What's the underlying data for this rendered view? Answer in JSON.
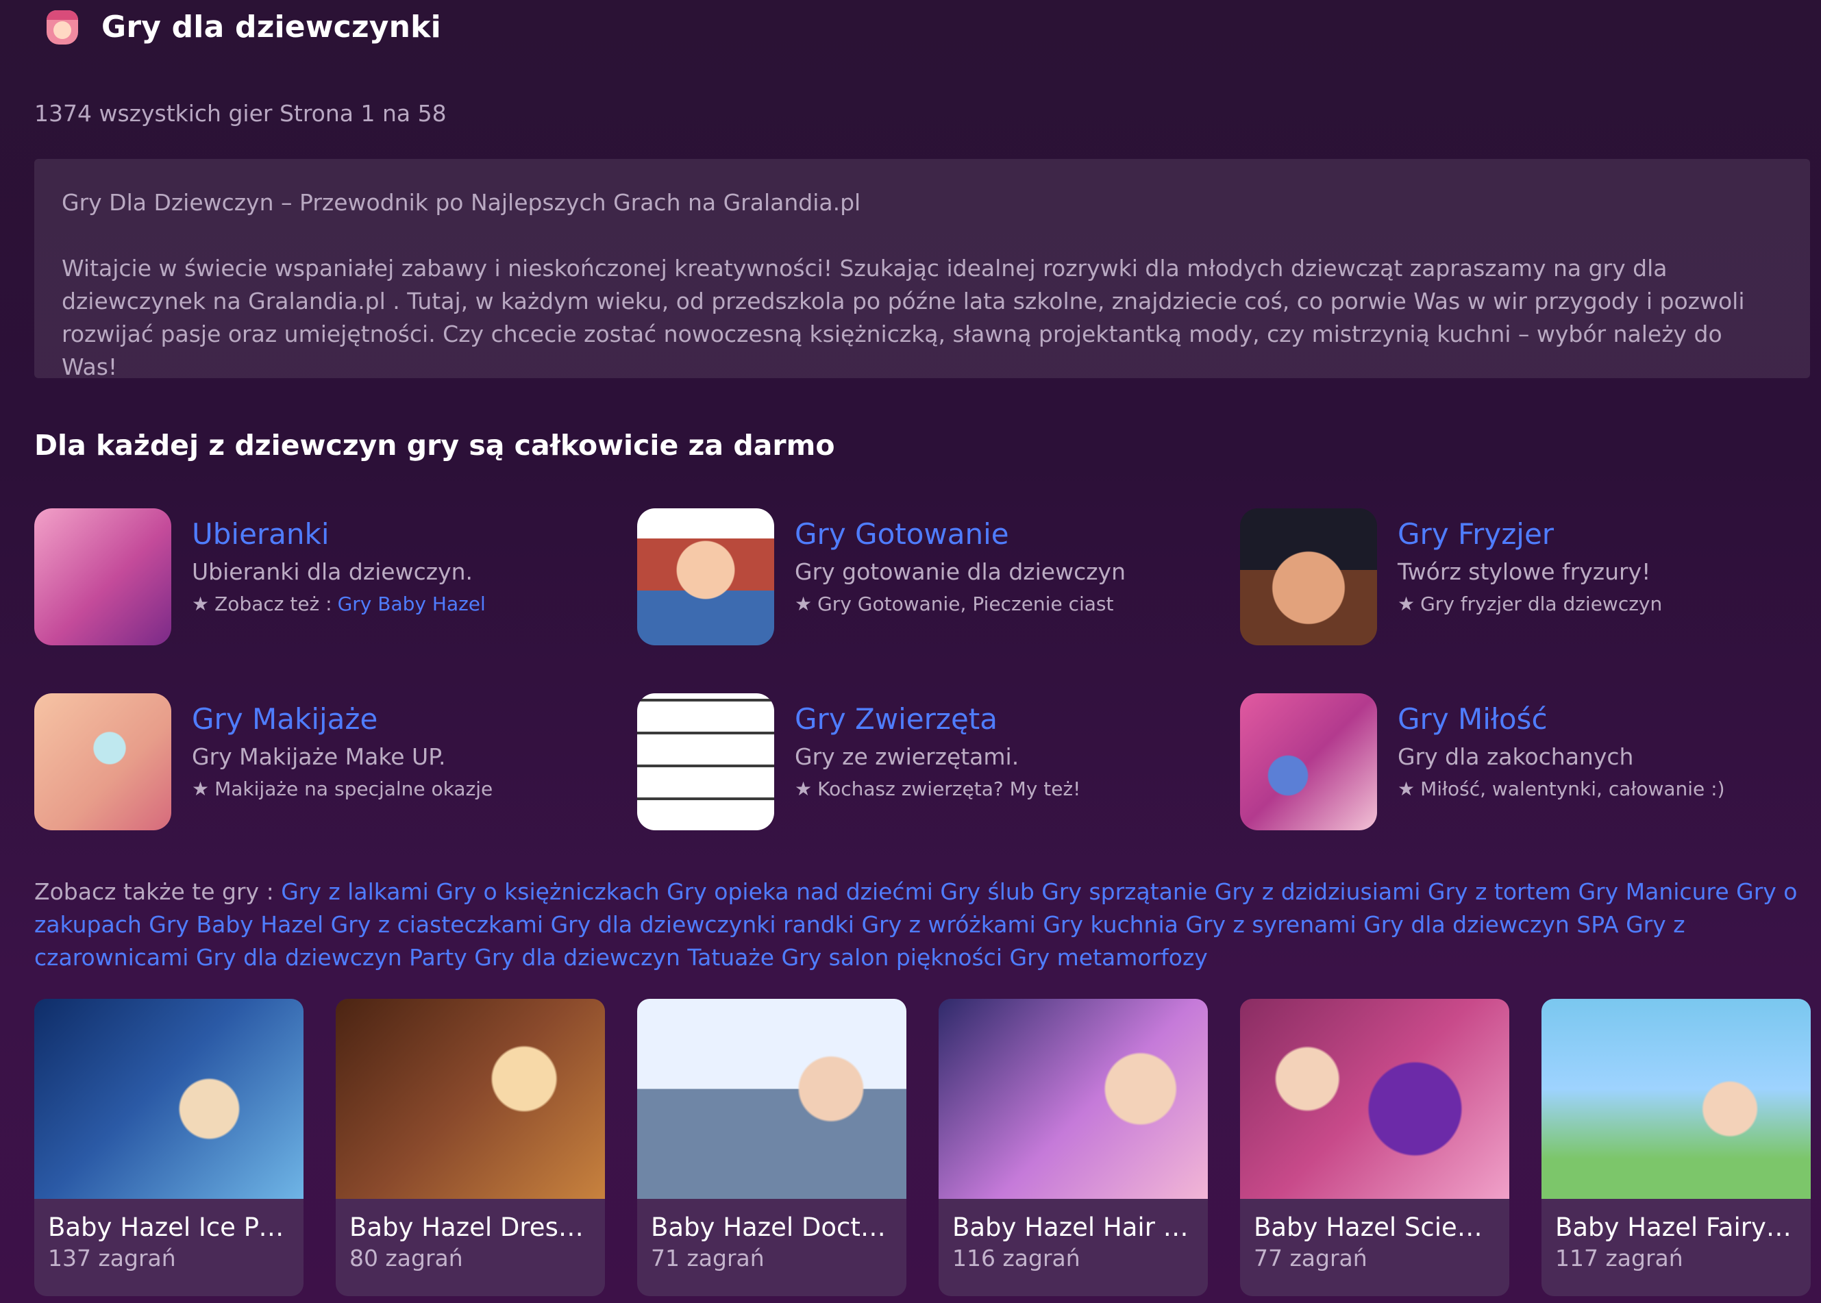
{
  "header": {
    "title": "Gry dla dziewczynki",
    "logo_icon": "girl-face-icon"
  },
  "stats": {
    "text": "1374 wszystkich gier Strona 1 na 58"
  },
  "description": {
    "title": "Gry Dla Dziewczyn – Przewodnik po Najlepszych Grach na Gralandia.pl",
    "body": "Witajcie w świecie wspaniałej zabawy i nieskończonej kreatywności! Szukając idealnej rozrywki dla młodych dziewcząt zapraszamy na gry dla dziewczynek na Gralandia.pl . Tutaj, w każdym wieku, od przedszkola po późne lata szkolne, znajdziecie coś, co porwie Was w wir przygody i pozwoli rozwijać pasje oraz umiejętności. Czy chcecie zostać nowoczesną księżniczką, sławną projektantką mody, czy mistrzynią kuchni – wybór należy do Was!"
  },
  "section": {
    "title": "Dla każdej z dziewczyn gry są całkowicie za darmo"
  },
  "categories": [
    {
      "name": "Ubieranki",
      "subtitle": "Ubieranki dla dziewczyn.",
      "see_prefix": "Zobacz też :",
      "see_link": "Gry Baby Hazel"
    },
    {
      "name": "Gry Gotowanie",
      "subtitle": "Gry gotowanie dla dziewczyn",
      "see_text": "Gry Gotowanie, Pieczenie ciast"
    },
    {
      "name": "Gry Fryzjer",
      "subtitle": "Twórz stylowe fryzury!",
      "see_text": "Gry fryzjer dla dziewczyn"
    },
    {
      "name": "Gry Makijaże",
      "subtitle": "Gry Makijaże Make UP.",
      "see_text": "Makijaże na specjalne okazje"
    },
    {
      "name": "Gry Zwierzęta",
      "subtitle": "Gry ze zwierzętami.",
      "see_text": "Kochasz zwierzęta? My też!"
    },
    {
      "name": "Gry Miłość",
      "subtitle": "Gry dla zakochanych",
      "see_text": "Miłość, walentynki, całowanie :)"
    }
  ],
  "also": {
    "prefix": "Zobacz także te gry :",
    "links": [
      "Gry z lalkami",
      "Gry o księżniczkach",
      "Gry opieka nad dziećmi",
      "Gry ślub",
      "Gry sprzątanie",
      "Gry z dzidziusiami",
      "Gry z tortem",
      "Gry Manicure",
      "Gry o zakupach",
      "Gry Baby Hazel",
      "Gry z ciasteczkami",
      "Gry dla dziewczynki randki",
      "Gry z wróżkami",
      "Gry kuchnia",
      "Gry z syrenami",
      "Gry dla dziewczyn SPA",
      "Gry z czarownicami",
      "Gry dla dziewczyn Party",
      "Gry dla dziewczyn Tatuaże",
      "Gry salon piękności",
      "Gry metamorfozy"
    ]
  },
  "games": [
    {
      "title": "Baby Hazel Ice Pri...",
      "plays": "137 zagrań"
    },
    {
      "title": "Baby Hazel Dress...",
      "plays": "80 zagrań"
    },
    {
      "title": "Baby Hazel Docto...",
      "plays": "71 zagrań"
    },
    {
      "title": "Baby Hazel Hair D...",
      "plays": "116 zagrań"
    },
    {
      "title": "Baby Hazel Scien...",
      "plays": "77 zagrań"
    },
    {
      "title": "Baby Hazel Fairyl...",
      "plays": "117 zagrań"
    }
  ],
  "colors": {
    "link": "#4f7dff",
    "background": "#2c1038",
    "card": "#4a2a57"
  }
}
